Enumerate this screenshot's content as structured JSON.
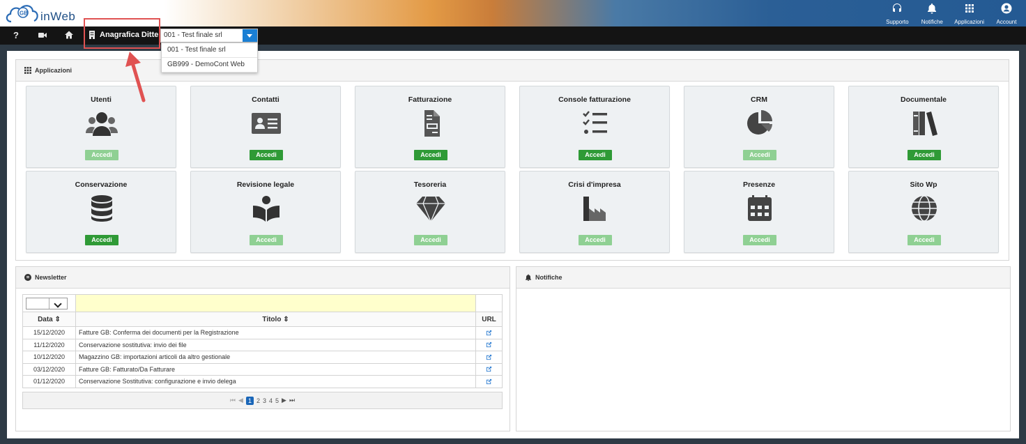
{
  "header": {
    "logo_text": "inWeb",
    "logo_badge": "GB",
    "actions": [
      {
        "label": "Supporto",
        "icon": "headset-icon"
      },
      {
        "label": "Notifiche",
        "icon": "bell-icon"
      },
      {
        "label": "Applicazioni",
        "icon": "grid-icon"
      },
      {
        "label": "Account",
        "icon": "user-circle-icon"
      }
    ]
  },
  "navbar": {
    "label": "Anagrafica Ditte",
    "selected_company": "001 - Test finale srl",
    "dropdown_options": [
      "001 - Test finale srl",
      "GB999 - DemoCont Web"
    ]
  },
  "apps_panel": {
    "title": "Applicazioni",
    "cards": [
      {
        "title": "Utenti",
        "button": "Accedi",
        "enabled": false,
        "icon": "users-icon"
      },
      {
        "title": "Contatti",
        "button": "Accedi",
        "enabled": true,
        "icon": "id-card-icon"
      },
      {
        "title": "Fatturazione",
        "button": "Accedi",
        "enabled": true,
        "icon": "invoice-icon"
      },
      {
        "title": "Console fatturazione",
        "button": "Accedi",
        "enabled": true,
        "icon": "checklist-icon"
      },
      {
        "title": "CRM",
        "button": "Accedi",
        "enabled": false,
        "icon": "pie-chart-icon"
      },
      {
        "title": "Documentale",
        "button": "Accedi",
        "enabled": true,
        "icon": "books-icon"
      },
      {
        "title": "Conservazione",
        "button": "Accedi",
        "enabled": true,
        "icon": "database-icon"
      },
      {
        "title": "Revisione legale",
        "button": "Accedi",
        "enabled": false,
        "icon": "reader-icon"
      },
      {
        "title": "Tesoreria",
        "button": "Accedi",
        "enabled": false,
        "icon": "diamond-icon"
      },
      {
        "title": "Crisi d'impresa",
        "button": "Accedi",
        "enabled": false,
        "icon": "industry-icon"
      },
      {
        "title": "Presenze",
        "button": "Accedi",
        "enabled": false,
        "icon": "calendar-icon"
      },
      {
        "title": "Sito Wp",
        "button": "Accedi",
        "enabled": false,
        "icon": "globe-icon"
      }
    ]
  },
  "newsletter": {
    "title": "Newsletter",
    "columns": [
      "Data",
      "Titolo",
      "URL"
    ],
    "rows": [
      {
        "date": "15/12/2020",
        "title": "Fatture GB: Conferma dei documenti per la Registrazione"
      },
      {
        "date": "11/12/2020",
        "title": "Conservazione sostitutiva: invio dei file"
      },
      {
        "date": "10/12/2020",
        "title": "Magazzino GB: importazioni articoli da altro gestionale"
      },
      {
        "date": "03/12/2020",
        "title": "Fatture GB: Fatturato/Da Fatturare"
      },
      {
        "date": "01/12/2020",
        "title": "Conservazione Sostitutiva: configurazione e invio delega"
      }
    ],
    "pager": {
      "pages": [
        "1",
        "2",
        "3",
        "4",
        "5"
      ],
      "current": "1"
    }
  },
  "notifications": {
    "title": "Notifiche"
  },
  "colors": {
    "button_enabled": "#2f9a36",
    "button_disabled": "#8fd093",
    "navbar": "#141414",
    "select_accent": "#1a7fd4",
    "highlight": "#e05252"
  }
}
